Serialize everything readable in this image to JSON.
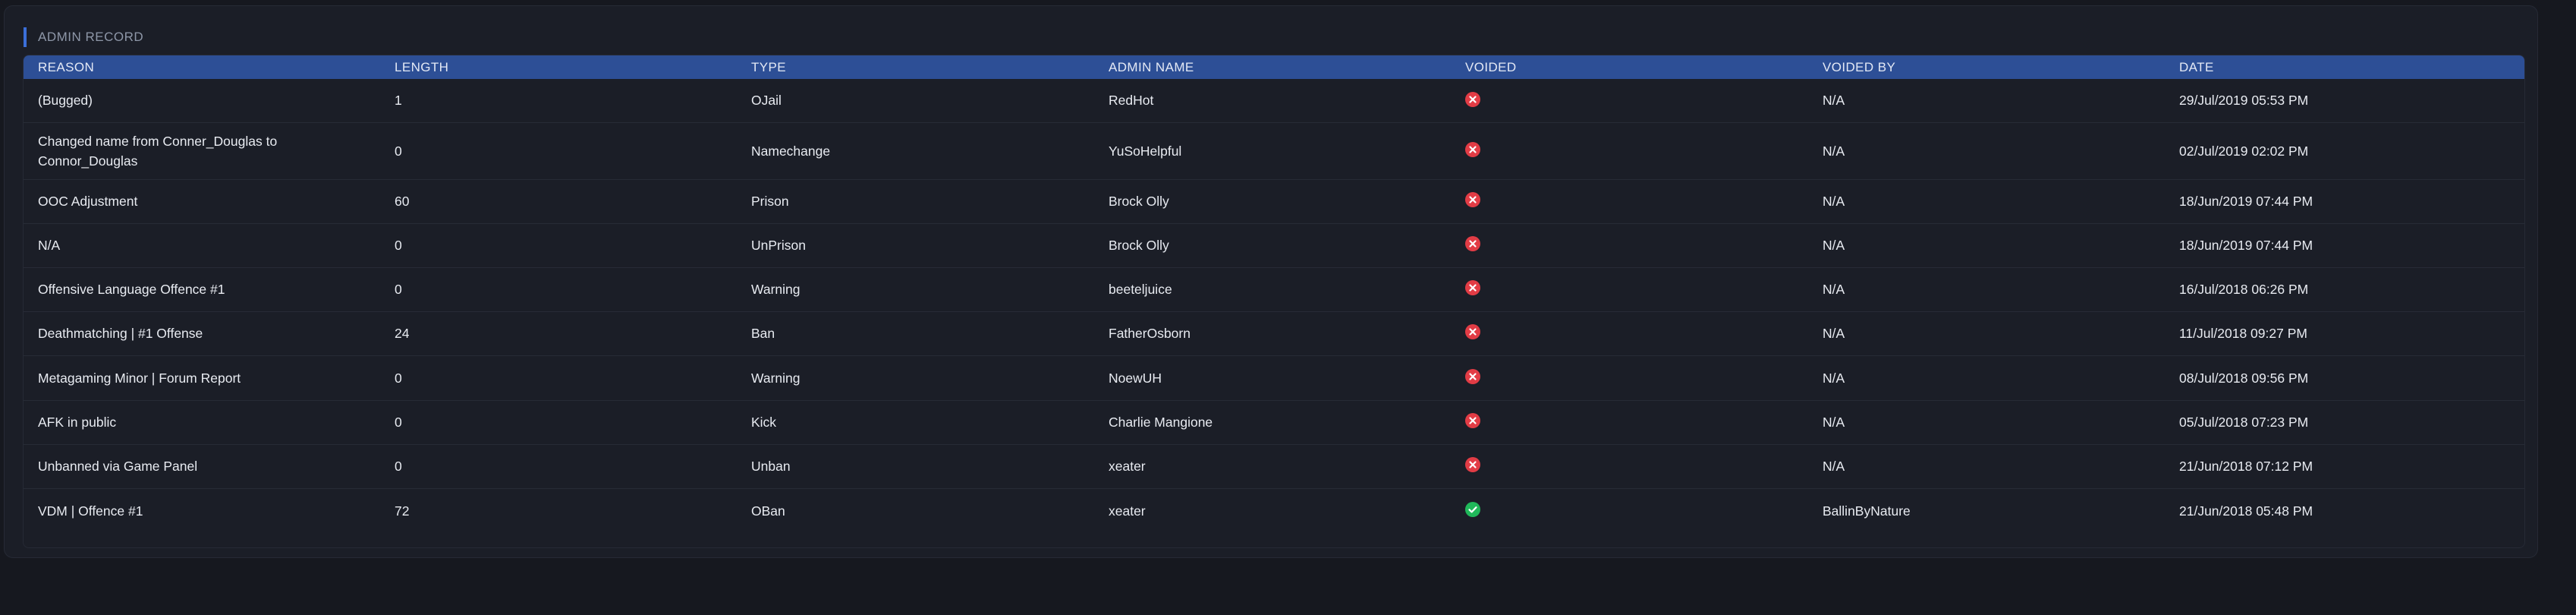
{
  "title": "ADMIN RECORD",
  "columns": [
    "REASON",
    "LENGTH",
    "TYPE",
    "ADMIN NAME",
    "VOIDED",
    "VOIDED BY",
    "DATE"
  ],
  "rows": [
    {
      "reason": "(Bugged)",
      "length": "1",
      "type": "OJail",
      "admin": "RedHot",
      "voided": false,
      "voided_by": "N/A",
      "date": "29/Jul/2019 05:53 PM"
    },
    {
      "reason": "Changed name from Conner_Douglas to Connor_Douglas",
      "length": "0",
      "type": "Namechange",
      "admin": "YuSoHelpful",
      "voided": false,
      "voided_by": "N/A",
      "date": "02/Jul/2019 02:02 PM"
    },
    {
      "reason": "OOC Adjustment",
      "length": "60",
      "type": "Prison",
      "admin": "Brock Olly",
      "voided": false,
      "voided_by": "N/A",
      "date": "18/Jun/2019 07:44 PM"
    },
    {
      "reason": "N/A",
      "length": "0",
      "type": "UnPrison",
      "admin": "Brock Olly",
      "voided": false,
      "voided_by": "N/A",
      "date": "18/Jun/2019 07:44 PM"
    },
    {
      "reason": "Offensive Language Offence #1",
      "length": "0",
      "type": "Warning",
      "admin": "beeteljuice",
      "voided": false,
      "voided_by": "N/A",
      "date": "16/Jul/2018 06:26 PM"
    },
    {
      "reason": "Deathmatching | #1 Offense",
      "length": "24",
      "type": "Ban",
      "admin": "FatherOsborn",
      "voided": false,
      "voided_by": "N/A",
      "date": "11/Jul/2018 09:27 PM"
    },
    {
      "reason": "Metagaming Minor | Forum Report",
      "length": "0",
      "type": "Warning",
      "admin": "NoewUH",
      "voided": false,
      "voided_by": "N/A",
      "date": "08/Jul/2018 09:56 PM"
    },
    {
      "reason": "AFK in public",
      "length": "0",
      "type": "Kick",
      "admin": "Charlie Mangione",
      "voided": false,
      "voided_by": "N/A",
      "date": "05/Jul/2018 07:23 PM"
    },
    {
      "reason": "Unbanned via Game Panel",
      "length": "0",
      "type": "Unban",
      "admin": "xeater",
      "voided": false,
      "voided_by": "N/A",
      "date": "21/Jun/2018 07:12 PM"
    },
    {
      "reason": "VDM | Offence #1",
      "length": "72",
      "type": "OBan",
      "admin": "xeater",
      "voided": true,
      "voided_by": "BallinByNature",
      "date": "21/Jun/2018 05:48 PM"
    }
  ],
  "icons": {
    "not_voided": "x-circle-icon",
    "voided": "check-circle-icon"
  },
  "colors": {
    "header_bg": "#2d4f96",
    "accent": "#3b6fd9",
    "x_red": "#e23c45",
    "check_green": "#20b85a"
  }
}
